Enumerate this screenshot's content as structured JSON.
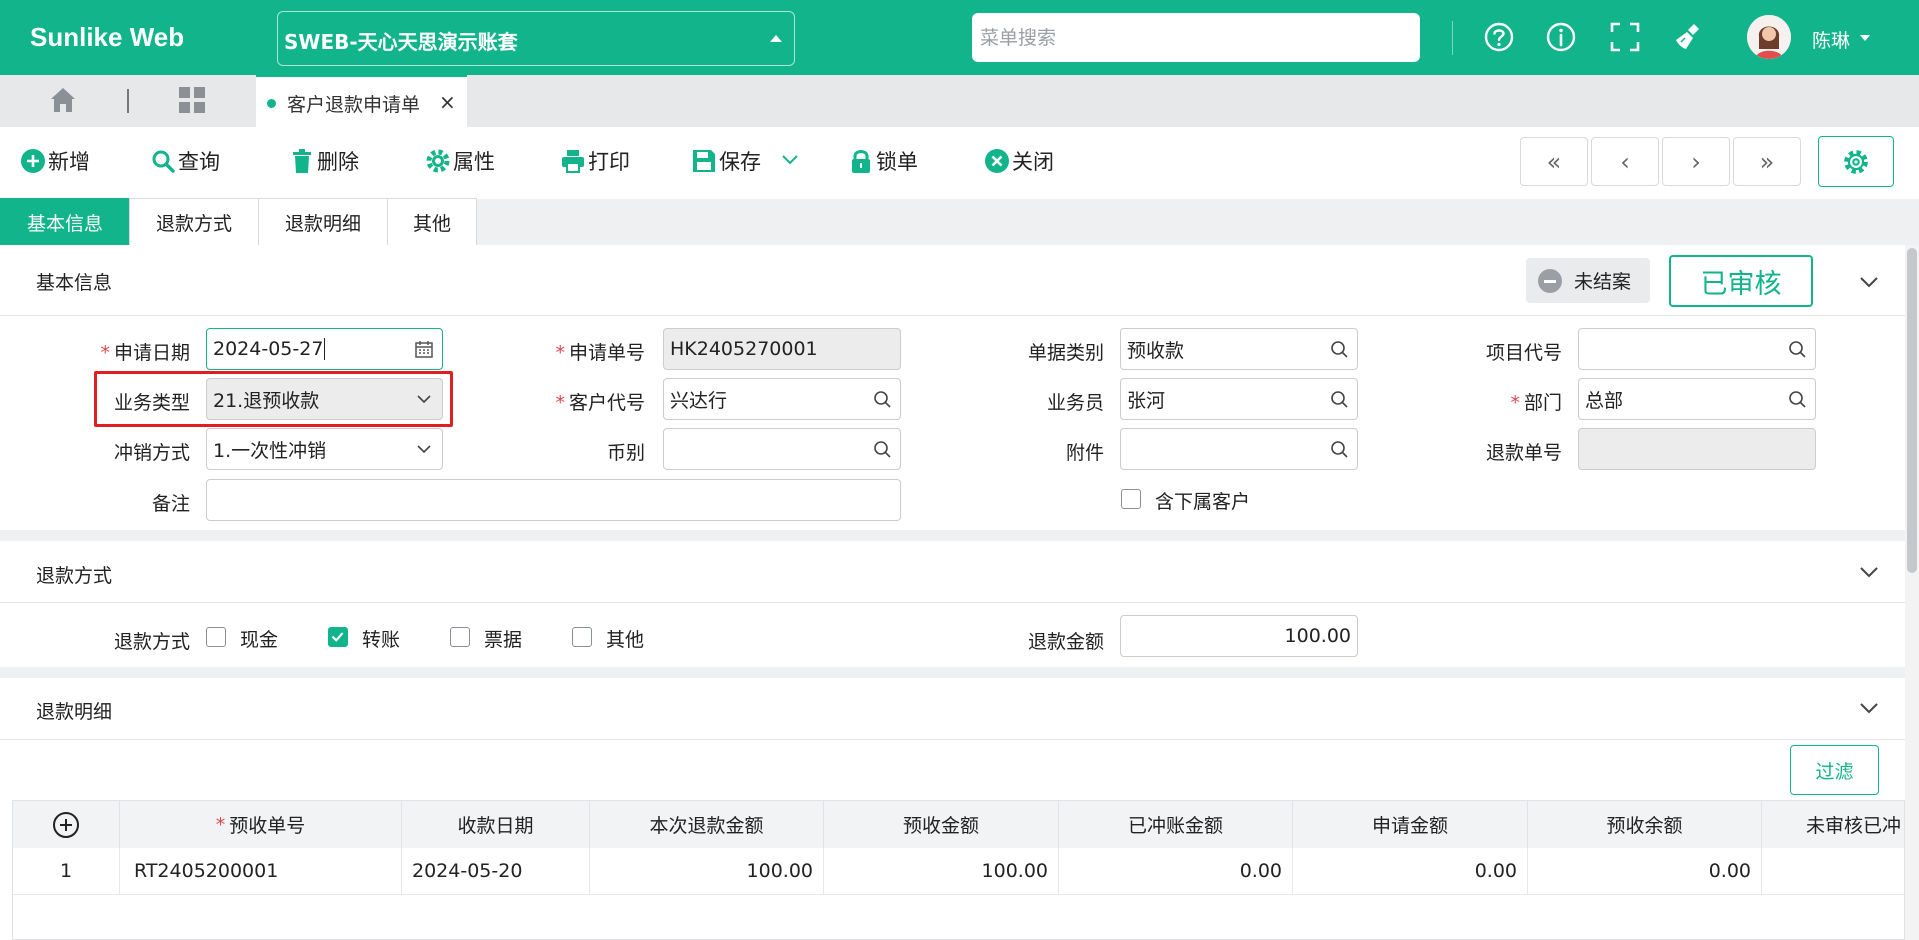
{
  "app": {
    "brand": "Sunlike Web",
    "account": "SWEB-天心天思演示账套",
    "search_placeholder": "菜单搜索",
    "user_name": "陈琳"
  },
  "tabs": {
    "active": "客户退款申请单"
  },
  "toolbar": {
    "new": "新增",
    "query": "查询",
    "delete": "删除",
    "properties": "属性",
    "print": "打印",
    "save": "保存",
    "lock": "锁单",
    "close": "关闭",
    "nav": [
      "«",
      "‹",
      "›",
      "»"
    ]
  },
  "section_tabs": [
    "基本信息",
    "退款方式",
    "退款明细",
    "其他"
  ],
  "basic": {
    "title": "基本信息",
    "status_closed": "未结案",
    "status_approved": "已审核",
    "apply_date_label": "申请日期",
    "apply_date": "2024-05-27",
    "apply_no_label": "申请单号",
    "apply_no": "HK2405270001",
    "doc_type_label": "单据类别",
    "doc_type": "预收款",
    "project_label": "项目代号",
    "project": "",
    "biz_type_label": "业务类型",
    "biz_type": "21.退预收款",
    "customer_label": "客户代号",
    "customer": "兴达行",
    "salesman_label": "业务员",
    "salesman": "张河",
    "dept_label": "部门",
    "dept": "总部",
    "offset_label": "冲销方式",
    "offset": "1.一次性冲销",
    "currency_label": "币别",
    "currency": "",
    "attachment_label": "附件",
    "attachment": "",
    "refund_no_label": "退款单号",
    "refund_no": "",
    "remark_label": "备注",
    "remark": "",
    "include_sub_label": "含下属客户"
  },
  "refund_method": {
    "title": "退款方式",
    "label": "退款方式",
    "options": [
      "现金",
      "转账",
      "票据",
      "其他"
    ],
    "checked": "转账",
    "amount_label": "退款金额",
    "amount": "100.00"
  },
  "detail": {
    "title": "退款明细",
    "filter": "过滤",
    "columns": [
      "预收单号",
      "收款日期",
      "本次退款金额",
      "预收金额",
      "已冲账金额",
      "申请金额",
      "预收余额",
      "未审核已冲"
    ],
    "rows": [
      [
        "1",
        "RT2405200001",
        "2024-05-20",
        "100.00",
        "100.00",
        "0.00",
        "0.00",
        "0.00",
        ""
      ]
    ]
  },
  "colors": {
    "primary": "#12b48b",
    "highlight": "#e02020",
    "required": "#e0474c"
  }
}
